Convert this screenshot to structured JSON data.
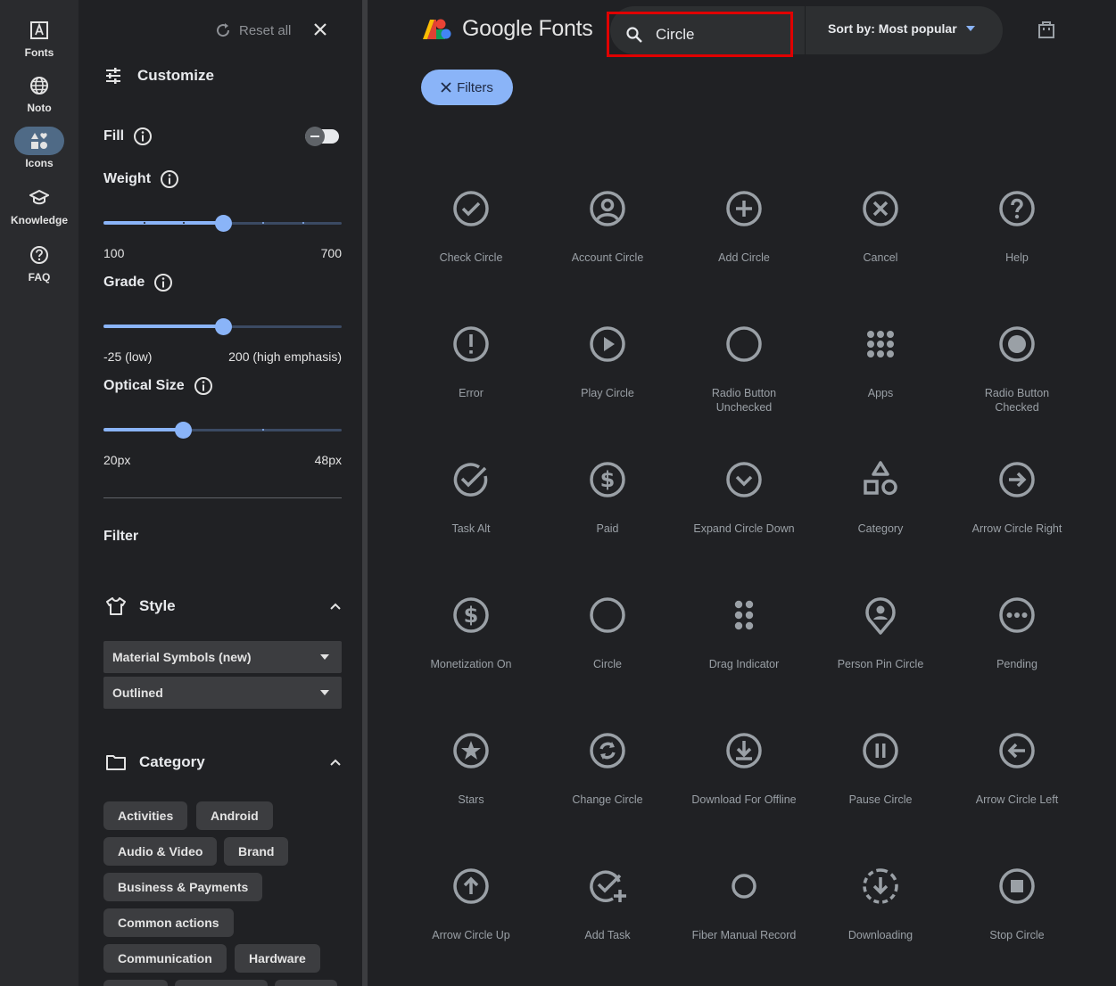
{
  "nav": {
    "items": [
      {
        "label": "Fonts",
        "icon": "font-icon"
      },
      {
        "label": "Noto",
        "icon": "globe-icon"
      },
      {
        "label": "Icons",
        "icon": "shapes-icon",
        "active": true
      },
      {
        "label": "Knowledge",
        "icon": "school-icon"
      },
      {
        "label": "FAQ",
        "icon": "help-icon"
      }
    ]
  },
  "panel": {
    "reset_label": "Reset all",
    "customize_title": "Customize",
    "fill_label": "Fill",
    "fill_on": false,
    "weight_label": "Weight",
    "weight_min": "100",
    "weight_max": "700",
    "weight_fraction": 0.5,
    "grade_label": "Grade",
    "grade_min": "-25 (low)",
    "grade_max": "200 (high emphasis)",
    "grade_fraction": 0.5,
    "optical_label": "Optical Size",
    "optical_min": "20px",
    "optical_max": "48px",
    "optical_fraction": 0.333,
    "filter_title": "Filter",
    "style_title": "Style",
    "style_select": "Material Symbols (new)",
    "variant_select": "Outlined",
    "category_title": "Category",
    "categories": [
      "Activities",
      "Android",
      "Audio & Video",
      "Brand",
      "Business & Payments",
      "Common actions",
      "Communication",
      "Hardware"
    ]
  },
  "header": {
    "logo_text": "Google Fonts",
    "search_value": "Circle",
    "sort_label": "Sort by: Most popular",
    "filters_label": "Filters"
  },
  "accent": "#8ab4f8",
  "icons": [
    [
      "Check Circle",
      "Account Circle",
      "Add Circle",
      "Cancel",
      "Help"
    ],
    [
      "Error",
      "Play Circle",
      "Radio Button Unchecked",
      "Apps",
      "Radio Button Checked"
    ],
    [
      "Task Alt",
      "Paid",
      "Expand Circle Down",
      "Category",
      "Arrow Circle Right"
    ],
    [
      "Monetization On",
      "Circle",
      "Drag Indicator",
      "Person Pin Circle",
      "Pending"
    ],
    [
      "Stars",
      "Change Circle",
      "Download For Offline",
      "Pause Circle",
      "Arrow Circle Left"
    ],
    [
      "Arrow Circle Up",
      "Add Task",
      "Fiber Manual Record",
      "Downloading",
      "Stop Circle"
    ]
  ]
}
